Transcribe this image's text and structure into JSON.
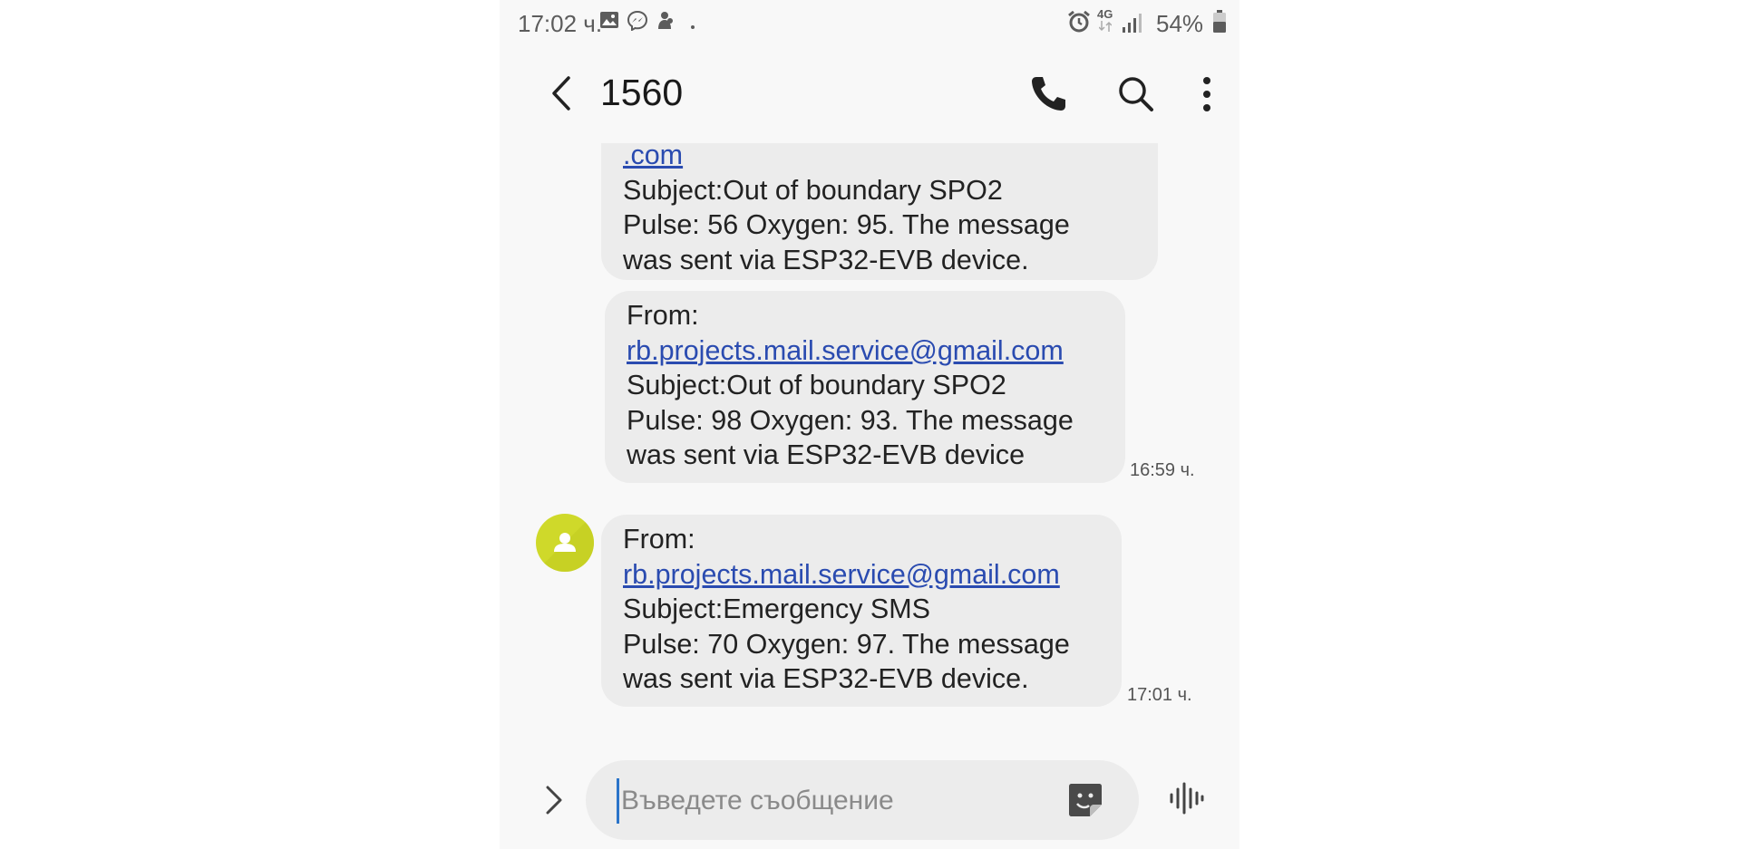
{
  "status_bar": {
    "time": "17:02 ч.",
    "network": "4G",
    "battery": "54%",
    "left_icons": [
      "gallery-icon",
      "messenger-icon",
      "hand-icon",
      "dot-icon"
    ],
    "right_icons": [
      "alarm-icon",
      "network-4g-icon",
      "signal-icon",
      "battery-icon"
    ]
  },
  "header": {
    "title": "1560",
    "icons": [
      "back-arrow-icon",
      "phone-icon",
      "search-icon",
      "more-vert-icon"
    ]
  },
  "messages": [
    {
      "lines": [
        ".com",
        "Subject:Out of boundary SPO2",
        "Pulse: 56 Oxygen: 95. The message",
        "was sent via ESP32-EVB device."
      ],
      "timestamp": ""
    },
    {
      "lines": [
        "From:",
        "rb.projects.mail.service@gmail.com",
        "Subject:Out of boundary SPO2",
        "Pulse: 98 Oxygen: 93. The message",
        "was sent via ESP32-EVB device"
      ],
      "timestamp": "16:59 ч."
    },
    {
      "lines": [
        "From:",
        "rb.projects.mail.service@gmail.com",
        "Subject:Emergency SMS",
        "Pulse: 70 Oxygen: 97. The message",
        "was sent via ESP32-EVB device."
      ],
      "timestamp": "17:01 ч."
    }
  ],
  "input": {
    "placeholder": "Въведете съобщение",
    "value": "",
    "icons": [
      "expand-arrow-icon",
      "sticker-icon",
      "voice-wave-icon"
    ]
  },
  "colors": {
    "avatar": "#cfd92a",
    "bubble": "#ececec",
    "link": "#2a4bb0",
    "background": "#f8f8f8"
  }
}
